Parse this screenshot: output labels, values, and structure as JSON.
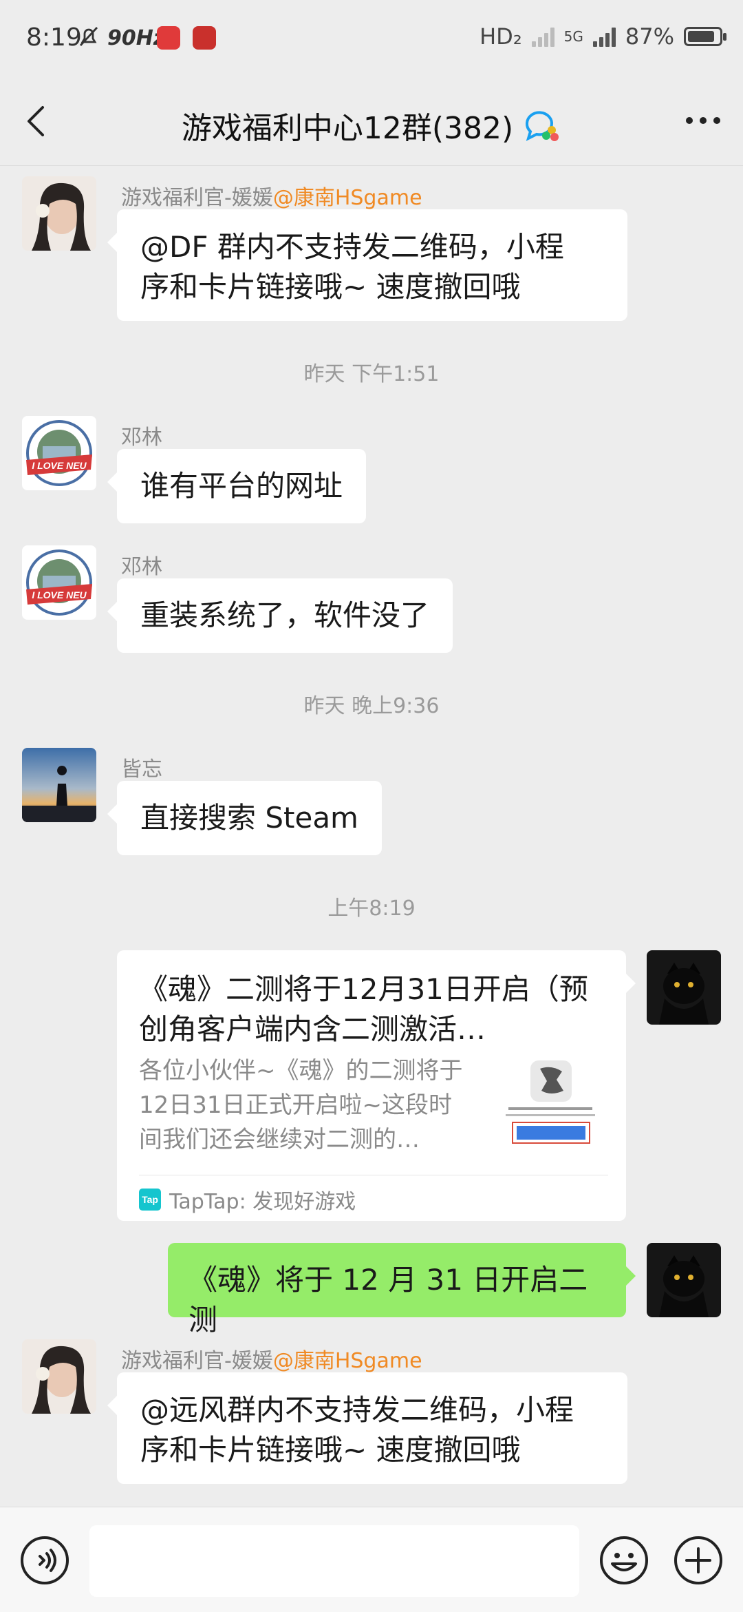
{
  "status_bar": {
    "time": "8:19",
    "refresh_rate": "90Hz",
    "hd_label": "HD₂",
    "network": "5G",
    "battery_percent": "87%",
    "battery_level": 0.87
  },
  "nav": {
    "title": "游戏福利中心12群(382)",
    "back_icon": "chevron-left-icon",
    "more_icon": "more-dots-icon"
  },
  "messages": {
    "m1": {
      "sender": "游戏福利官-媛媛",
      "mention": "@康南HSgame",
      "line1": "@DF 群内不支持发二维码，小程",
      "line2": "序和卡片链接哦~ 速度撤回哦"
    },
    "ts1": "昨天 下午1:51",
    "m2": {
      "sender": "邓林",
      "text": "谁有平台的网址"
    },
    "m3": {
      "sender": "邓林",
      "text": "重装系统了，软件没了"
    },
    "ts2": "昨天 晚上9:36",
    "m4": {
      "sender": "皆忘",
      "text": "直接搜索 Steam"
    },
    "ts3": "上午8:19",
    "card": {
      "title": "《魂》二测将于12月31日开启（预创角客户端内含二测激活…",
      "desc": "各位小伙伴~《魂》的二测将于12日31日正式开启啦~这段时间我们还会继续对二测的…",
      "source": "TapTap: 发现好游戏",
      "source_icon": "Tap"
    },
    "m6": {
      "text": "《魂》将于 12 月 31 日开启二测"
    },
    "m7": {
      "sender": "游戏福利官-媛媛",
      "mention": "@康南HSgame",
      "line1": "@远风群内不支持发二维码，小程",
      "line2": "序和卡片链接哦~ 速度撤回哦"
    }
  },
  "input_bar": {
    "voice_icon": "voice-icon",
    "emoji_icon": "emoji-icon",
    "plus_icon": "plus-icon"
  },
  "colors": {
    "background": "#ededed",
    "bubble_self": "#95ec69",
    "bubble_other": "#ffffff",
    "mention": "#f08a24"
  }
}
